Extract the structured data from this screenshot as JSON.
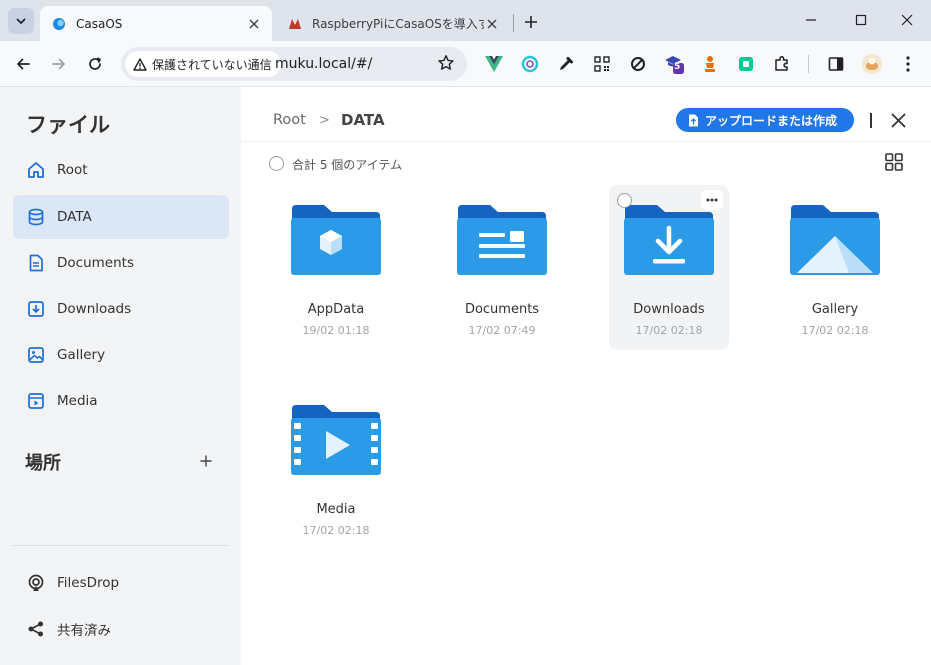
{
  "browser": {
    "tabs": [
      {
        "title": "CasaOS",
        "active": true
      },
      {
        "title": "RaspberryPiにCasaOSを導入する",
        "active": false
      }
    ],
    "security_label": "保護されていない通信",
    "url": "muku.local/#/",
    "extension_badge": "5"
  },
  "sidebar": {
    "title": "ファイル",
    "items": [
      {
        "label": "Root",
        "icon": "home-icon"
      },
      {
        "label": "DATA",
        "icon": "database-icon"
      },
      {
        "label": "Documents",
        "icon": "document-icon"
      },
      {
        "label": "Downloads",
        "icon": "download-icon"
      },
      {
        "label": "Gallery",
        "icon": "image-icon"
      },
      {
        "label": "Media",
        "icon": "video-icon"
      }
    ],
    "places_title": "場所",
    "bottom_items": [
      {
        "label": "FilesDrop",
        "icon": "filesdrop-icon"
      },
      {
        "label": "共有済み",
        "icon": "share-icon"
      }
    ]
  },
  "main": {
    "breadcrumb": {
      "root": "Root",
      "separator": ">",
      "current": "DATA"
    },
    "upload_label": "アップロードまたは作成",
    "item_count": "合計 5 個のアイテム",
    "items": [
      {
        "name": "AppData",
        "date": "19/02 01:18",
        "icon": "appdata-folder-icon"
      },
      {
        "name": "Documents",
        "date": "17/02 07:49",
        "icon": "documents-folder-icon"
      },
      {
        "name": "Downloads",
        "date": "17/02 02:18",
        "icon": "downloads-folder-icon"
      },
      {
        "name": "Gallery",
        "date": "17/02 02:18",
        "icon": "gallery-folder-icon"
      },
      {
        "name": "Media",
        "date": "17/02 02:18",
        "icon": "media-folder-icon"
      }
    ]
  },
  "colors": {
    "accent": "#2176e8",
    "folder_back": "#1565c0",
    "folder_front": "#2b9be8",
    "sidebar_active": "#dbe6f7"
  }
}
